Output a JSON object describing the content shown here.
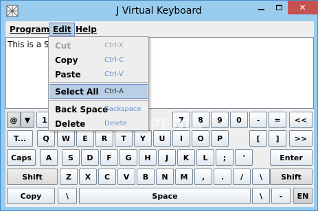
{
  "window": {
    "title": "J Virtual Keyboard",
    "close_glyph": "✕"
  },
  "menubar": {
    "program": "Program",
    "edit": "Edit",
    "help": "Help"
  },
  "textarea": {
    "value": "This is a So"
  },
  "edit_menu": {
    "items": [
      {
        "label": "Cut",
        "shortcut": "Ctrl-X",
        "disabled": true
      },
      {
        "label": "Copy",
        "shortcut": "Ctrl-C"
      },
      {
        "label": "Paste",
        "shortcut": "Ctrl-V"
      },
      {
        "label": "Select All",
        "shortcut": "Ctrl-A",
        "selected": true
      },
      {
        "label": "Back Space",
        "shortcut": "Backspace"
      },
      {
        "label": "Delete",
        "shortcut": "Delete"
      }
    ]
  },
  "keyboard": {
    "row1": {
      "lang": "@",
      "arrow": "▼",
      "k1": "1",
      "k7": "7",
      "k8": "8",
      "k9": "9",
      "k0": "0",
      "minus": "-",
      "equals": "=",
      "back": "<<"
    },
    "row2": {
      "tab": "T...",
      "q": "Q",
      "w": "W",
      "e": "E",
      "r": "R",
      "t": "T",
      "y": "Y",
      "u": "U",
      "i": "I",
      "o": "O",
      "p": "P",
      "lbr": "[",
      "rbr": "]",
      "fwd": ">>"
    },
    "row3": {
      "caps": "Caps",
      "a": "A",
      "s": "S",
      "d": "D",
      "f": "F",
      "g": "G",
      "h": "H",
      "j": "J",
      "k": "K",
      "l": "L",
      "semi": ";",
      "quote": "'",
      "enter": "Enter"
    },
    "row4": {
      "shift_l": "Shift",
      "z": "Z",
      "x": "X",
      "c": "C",
      "v": "V",
      "b": "B",
      "n": "N",
      "m": "M",
      "comma": ",",
      "dot": ".",
      "slash": "/",
      "bslash": "\\",
      "shift_r": "Shift"
    },
    "row5": {
      "copy": "Copy",
      "bslash": "\\",
      "space": "Space",
      "bslash2": "\\",
      "dash": "-",
      "lang": "EN"
    }
  },
  "watermark": "SOFTPEDIA"
}
